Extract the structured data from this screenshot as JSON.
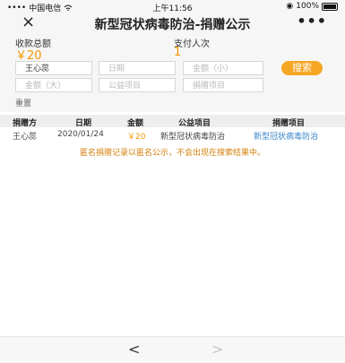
{
  "status": {
    "carrier": "中国电信",
    "time": "上午11:56",
    "battery": "100%"
  },
  "nav": {
    "close_icon": "×",
    "title": "新型冠状病毒防治-捐赠公示",
    "more_icon": "•••"
  },
  "summary": {
    "total_label": "收款总额",
    "total_value": "￥20",
    "count_label": "支付人次",
    "count_value": "1"
  },
  "filters": {
    "name": "王心蕊",
    "date_placeholder": "日期",
    "amount_min_placeholder": "金额（小）",
    "amount_max_placeholder": "金额（大）",
    "project_placeholder": "公益项目",
    "donate_project_placeholder": "捐赠项目",
    "search_label": "搜索",
    "reset_label": "重置"
  },
  "table": {
    "headers": [
      "捐赠方",
      "日期",
      "金额",
      "公益项目",
      "捐赠项目"
    ],
    "rows": [
      [
        "王心蕊",
        "2020/01/24",
        "￥20",
        "新型冠状病毒防治",
        "新型冠状病毒防治"
      ]
    ],
    "notice": "匿名捐赠记录以匿名公示，不会出现在搜索结果中。"
  },
  "bottom": {
    "back_icon": "<",
    "forward_icon": ">"
  },
  "colors": {
    "accent": "#f5a623",
    "amount": "#f39800",
    "link": "#3a86c8"
  }
}
